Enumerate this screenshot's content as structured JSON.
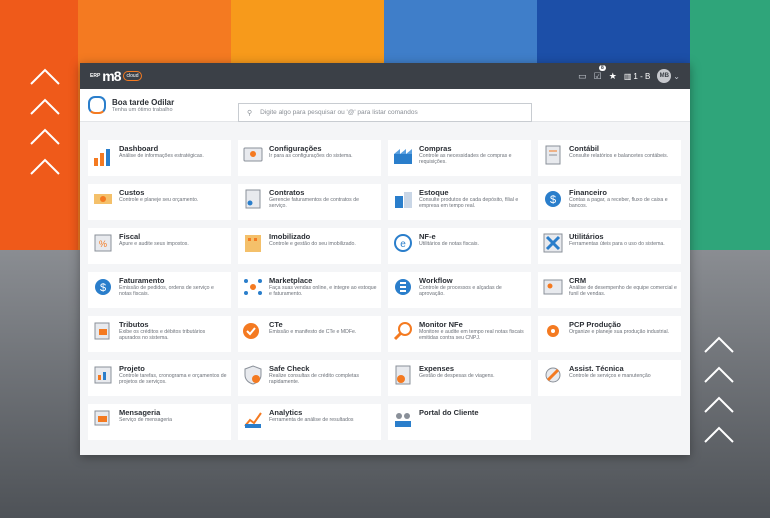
{
  "app": {
    "logo_erp": "ERP",
    "logo_m8": "m8",
    "logo_cloud": "cloud",
    "notif_count": "8",
    "company": "1 - B",
    "avatar": "MB"
  },
  "greeting": {
    "title": "Boa tarde Odilar",
    "subtitle": "Tenha um ótimo trabalho"
  },
  "search": {
    "placeholder": "Digite algo para pesquisar ou '@' para listar comandos"
  },
  "modules": [
    {
      "title": "Dashboard",
      "desc": "Análise de informações estratégicas."
    },
    {
      "title": "Configurações",
      "desc": "Ir para as configurações do sistema."
    },
    {
      "title": "Compras",
      "desc": "Controle as necessidades de compras e requisições."
    },
    {
      "title": "Contábil",
      "desc": "Consulte relatórios e balancetes contábeis."
    },
    {
      "title": "Custos",
      "desc": "Controle e planeje seu orçamento."
    },
    {
      "title": "Contratos",
      "desc": "Gerencie faturamentos de contratos de serviço."
    },
    {
      "title": "Estoque",
      "desc": "Consulte produtos de cada depósito, filial e empresa em tempo real."
    },
    {
      "title": "Financeiro",
      "desc": "Contas a pagar, a receber, fluxo de caixa e bancos."
    },
    {
      "title": "Fiscal",
      "desc": "Apure e audite seus impostos."
    },
    {
      "title": "Imobilizado",
      "desc": "Controle e gestão do seu imobilizado."
    },
    {
      "title": "NF-e",
      "desc": "Utilitários de notas fiscais."
    },
    {
      "title": "Utilitários",
      "desc": "Ferramentas úteis para o uso do sistema."
    },
    {
      "title": "Faturamento",
      "desc": "Emissão de pedidos, ordens de serviço e notas fiscais."
    },
    {
      "title": "Marketplace",
      "desc": "Faça suas vendas online, e integre ao estoque e faturamento."
    },
    {
      "title": "Workflow",
      "desc": "Controle de processos e alçadas de aprovação."
    },
    {
      "title": "CRM",
      "desc": "Análise de desempenho de equipe comercial e funil de vendas."
    },
    {
      "title": "Tributos",
      "desc": "Exibe os créditos e débitos tributários apurados no sistema."
    },
    {
      "title": "CTe",
      "desc": "Emissão e manifesto de CTe e MDFe."
    },
    {
      "title": "Monitor NFe",
      "desc": "Monitore e audite em tempo real notas fiscais emitidas contra seu CNPJ."
    },
    {
      "title": "PCP Produção",
      "desc": "Organize e planeje sua produção industrial."
    },
    {
      "title": "Projeto",
      "desc": "Controle tarefas, cronograma e orçamentos de projetos de serviços."
    },
    {
      "title": "Safe Check",
      "desc": "Realize consultas de crédito completas rapidamente."
    },
    {
      "title": "Expenses",
      "desc": "Gestão de despesas de viagens."
    },
    {
      "title": "Assist. Técnica",
      "desc": "Controle de serviços e manutenção"
    },
    {
      "title": "Mensageria",
      "desc": "Serviço de mensageria"
    },
    {
      "title": "Analytics",
      "desc": "Ferramenta de análise de resultados"
    },
    {
      "title": "Portal do Cliente",
      "desc": ""
    }
  ],
  "icons": [
    "bar-chart-icon",
    "settings-screen-icon",
    "factory-icon",
    "document-ledger-icon",
    "money-icon",
    "contract-icon",
    "warehouse-icon",
    "dollar-coin-icon",
    "percent-icon",
    "building-icon",
    "e-invoice-icon",
    "tools-icon",
    "dollar-circle-icon",
    "network-icon",
    "workflow-icon",
    "crm-card-icon",
    "tax-docs-icon",
    "delivery-truck-icon",
    "magnifier-icon",
    "gear-icon",
    "project-chart-icon",
    "shield-check-icon",
    "expense-dollar-icon",
    "technician-icon",
    "messages-icon",
    "analytics-chart-icon",
    "customer-portal-icon"
  ],
  "colors": {
    "accent": "#f47a21",
    "blue": "#2a7ecb",
    "topbar": "#3b4047"
  }
}
